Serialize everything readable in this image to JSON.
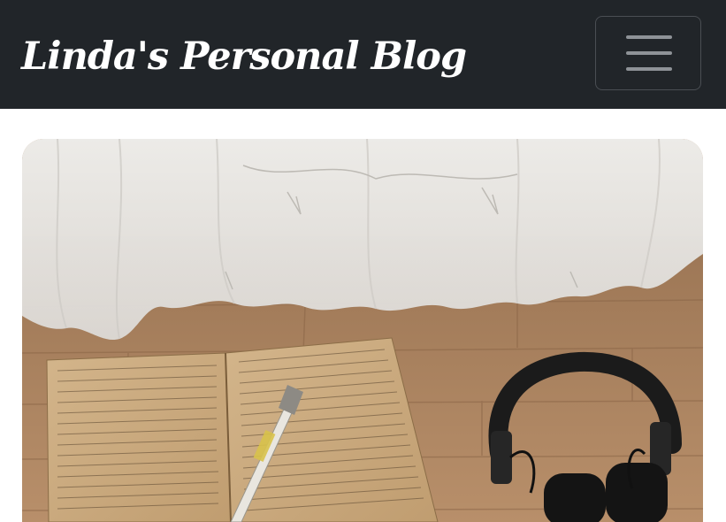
{
  "navbar": {
    "brand": "Linda's Personal Blog",
    "toggler_icon": "hamburger-menu-icon"
  },
  "hero": {
    "image": "photo-open-notebook-pen-headphones-on-wood-floor-by-curtain"
  },
  "colors": {
    "navbar_bg": "#212529",
    "brand_text": "#ffffff",
    "toggler_border": "#4a4e53",
    "toggler_lines": "#8e9297",
    "floor_wood": "#b08a66",
    "curtain": "#e8e6e3",
    "notebook_paper": "#c9a77c",
    "headphones": "#1b1b1b"
  }
}
